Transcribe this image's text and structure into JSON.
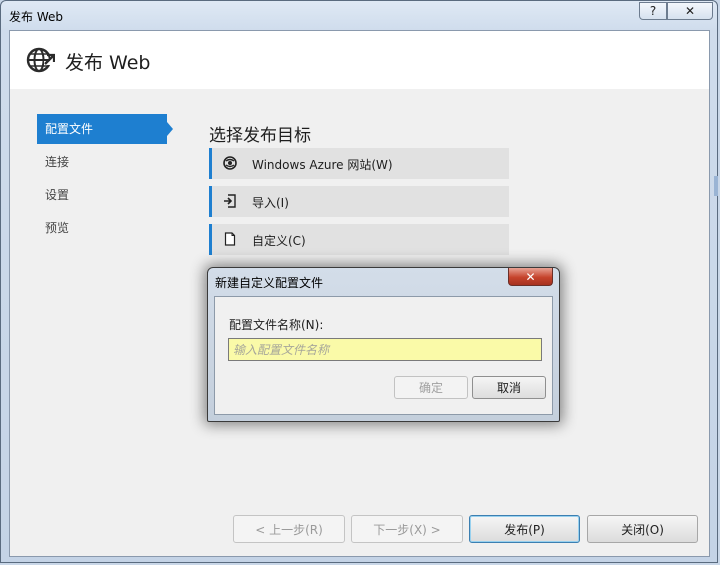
{
  "window": {
    "title": "发布 Web",
    "help_label": "?",
    "close_label": "✕"
  },
  "header": {
    "icon": "globe-publish-icon",
    "title": "发布 Web"
  },
  "nav": {
    "items": [
      {
        "label": "配置文件",
        "active": true
      },
      {
        "label": "连接"
      },
      {
        "label": "设置"
      },
      {
        "label": "预览"
      }
    ]
  },
  "main": {
    "section_title": "选择发布目标",
    "targets": [
      {
        "label": "Windows Azure 网站(W)",
        "icon": "azure-icon"
      },
      {
        "label": "导入(I)",
        "icon": "import-icon"
      },
      {
        "label": "自定义(C)",
        "icon": "document-icon"
      }
    ]
  },
  "dialog": {
    "title": "新建自定义配置文件",
    "close_label": "✕",
    "field_label": "配置文件名称(N):",
    "input_value": "",
    "input_placeholder": "输入配置文件名称",
    "ok_label": "确定",
    "cancel_label": "取消"
  },
  "footer": {
    "prev_label": "< 上一步(R)",
    "next_label": "下一步(X) >",
    "publish_label": "发布(P)",
    "close_label": "关闭(O)"
  },
  "colors": {
    "accent": "#1e7fd0",
    "input_bg": "#fafaa8",
    "close_red": "#c6432c"
  }
}
